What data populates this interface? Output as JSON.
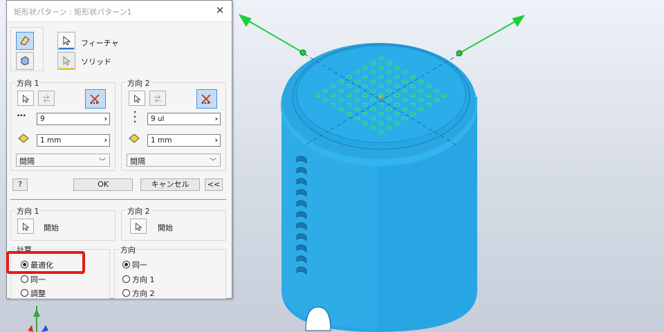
{
  "dialog": {
    "title": "矩形状パターン : 矩形状パターン1",
    "feature_label": "フィーチャ",
    "solid_label": "ソリッド",
    "dir1": {
      "title": "方向 1",
      "count": "9",
      "spacing": "1 mm",
      "mode": "間隔"
    },
    "dir2": {
      "title": "方向 2",
      "count": "9 ul",
      "spacing": "1 mm",
      "mode": "間隔"
    },
    "ok": "OK",
    "cancel": "キャンセル",
    "collapse": "<<",
    "start1": {
      "title": "方向 1",
      "label": "開始"
    },
    "start2": {
      "title": "方向 2",
      "label": "開始"
    },
    "compute": {
      "title": "計算",
      "options": [
        "最適化",
        "同一",
        "調整"
      ],
      "selected": "最適化"
    },
    "orientation": {
      "title": "方向",
      "options": [
        "同一",
        "方向 1",
        "方向 2"
      ],
      "selected": "同一"
    }
  },
  "colors": {
    "model_blue": "#2aa9e6",
    "hole_green": "#30e060",
    "arrow_green": "#1fcf3a",
    "highlight_red": "#e21c1c"
  }
}
